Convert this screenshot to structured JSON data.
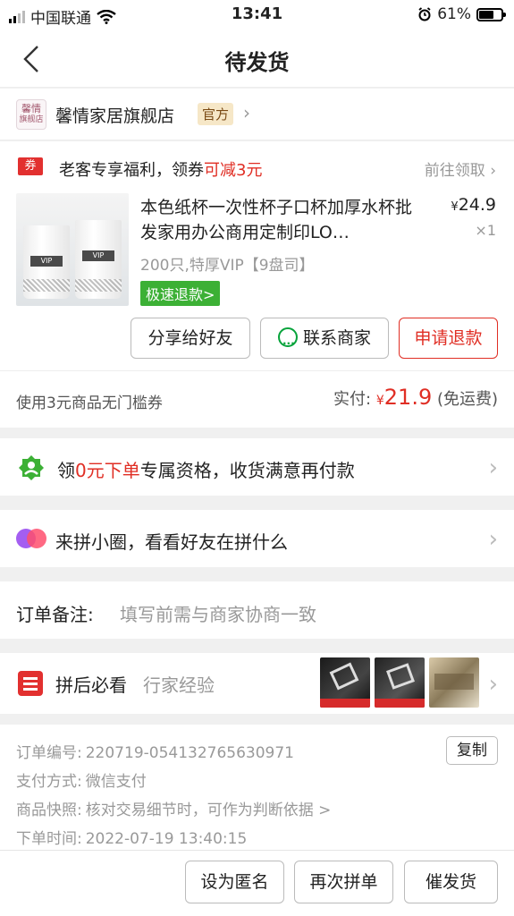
{
  "status": {
    "carrier": "中国联通",
    "time": "13:41",
    "battery": "61%"
  },
  "nav": {
    "title": "待发货"
  },
  "shop": {
    "logo_line1": "馨情",
    "logo_line2": "旗舰店",
    "name": "馨情家居旗舰店",
    "tag": "官方"
  },
  "coupon": {
    "icon": "券",
    "text_prefix": "老客专享福利，领券",
    "text_highlight": "可减3元",
    "action": "前往领取"
  },
  "product": {
    "title": "本色纸杯一次性杯子口杯加厚水杯批发家用办公商用定制印LO…",
    "price_symbol": "¥",
    "price": "24.9",
    "qty": "×1",
    "spec": "200只,特厚VIP【9盘司】",
    "tag": "极速退款>",
    "cup_label": "VIP"
  },
  "actions": {
    "share": "分享给好友",
    "contact": "联系商家",
    "refund": "申请退款"
  },
  "payment": {
    "coupon_note": "使用3元商品无门槛券",
    "paid_label": "实付:",
    "currency": "¥",
    "amount": "21.9",
    "shipping": "(免运费)"
  },
  "promo": {
    "prefix": "领",
    "highlight": "0元下单",
    "suffix": "专属资格，收货满意再付款"
  },
  "circle": {
    "text": "来拼小圈，看看好友在拼什么"
  },
  "note": {
    "label": "订单备注:",
    "placeholder": "填写前需与商家协商一致"
  },
  "guide": {
    "title": "拼后必看",
    "subtitle": "行家经验"
  },
  "order_info": {
    "number_label": "订单编号:",
    "number": "220719-054132765630971",
    "copy": "复制",
    "pay_label": "支付方式:",
    "pay_method": "微信支付",
    "snapshot_label": "商品快照:",
    "snapshot": "核对交易细节时，可作为判断依据 >",
    "time_label": "下单时间:",
    "time": "2022-07-19 13:40:15"
  },
  "bottom": {
    "anonymous": "设为匿名",
    "rebuy": "再次拼单",
    "urge": "催发货"
  },
  "colors": {
    "accent_red": "#e02e24",
    "green": "#3cb035",
    "official_tag": "#f6e7c7"
  }
}
